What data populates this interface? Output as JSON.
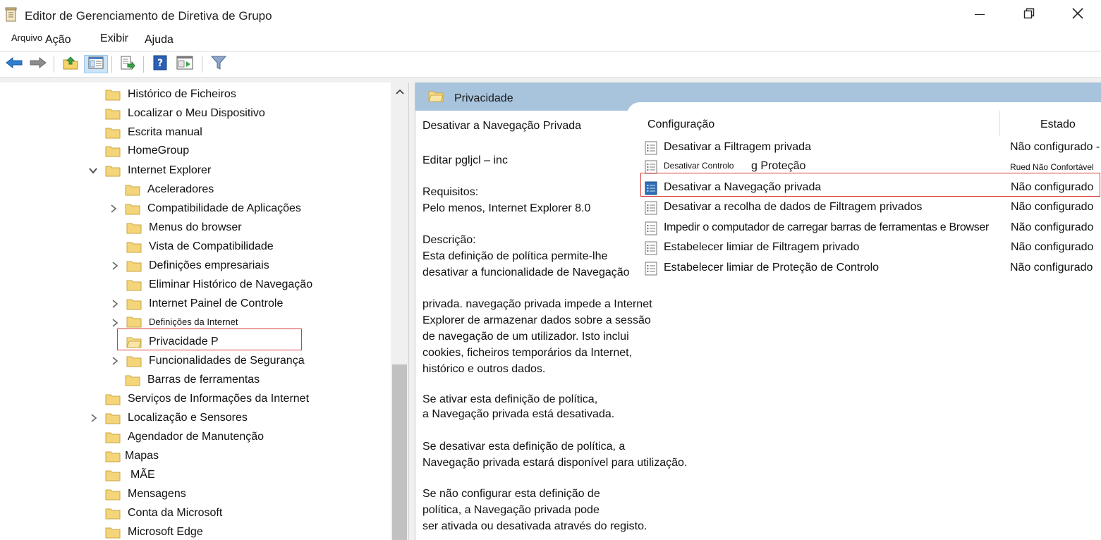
{
  "window": {
    "title": "Editor de Gerenciamento de Diretiva de Grupo",
    "icon": "policy-editor-icon"
  },
  "menu": {
    "file": "Arquivo",
    "action": "Ação",
    "view": "Exibir",
    "help": "Ajuda"
  },
  "toolbar": {
    "icons": [
      "back-arrow-icon",
      "forward-arrow-icon",
      "up-folder-icon",
      "show-hide-tree-icon",
      "export-list-icon",
      "help-icon",
      "properties-icon",
      "filter-icon"
    ]
  },
  "tree": {
    "items": [
      {
        "label": "Histórico de Ficheiros"
      },
      {
        "label": "Localizar o Meu Dispositivo"
      },
      {
        "label": "Escrita manual"
      },
      {
        "label": "HomeGroup"
      },
      {
        "label": "Internet Explorer"
      },
      {
        "label": "Aceleradores"
      },
      {
        "label": "Compatibilidade de Aplicações"
      },
      {
        "label": "Menus do browser"
      },
      {
        "label": "Vista de Compatibilidade"
      },
      {
        "label": "Definições empresariais"
      },
      {
        "label": "Eliminar Histórico de Navegação"
      },
      {
        "label": "Internet Painel de Controle"
      },
      {
        "label": "Definições da Internet"
      },
      {
        "label": "Privacidade P"
      },
      {
        "label": "Funcionalidades de Segurança"
      },
      {
        "label": "Barras de ferramentas"
      },
      {
        "label": "Serviços de Informações da Internet"
      },
      {
        "label": "Localização e Sensores"
      },
      {
        "label": "Agendador de Manutenção"
      },
      {
        "label": "Mapas"
      },
      {
        "label": "MÃE"
      },
      {
        "label": "Mensagens"
      },
      {
        "label": "Conta da Microsoft"
      },
      {
        "label": "Microsoft Edge"
      }
    ]
  },
  "details": {
    "header_title": "Privacidade",
    "description_lines": [
      "Desativar a Navegação Privada",
      "Editar pgljcl – inc",
      "Requisitos:",
      "Pelo menos, Internet Explorer 8.0",
      "Descrição:",
      "Esta definição de política permite-lhe",
      "desativar a funcionalidade de Navegação",
      "privada. navegação privada impede a Internet",
      "Explorer de armazenar dados sobre a sessão",
      "de navegação de um utilizador. Isto inclui",
      "cookies, ficheiros temporários da Internet,",
      "histórico e outros dados.",
      "Se ativar esta definição de política,",
      "a Navegação privada está desativada.",
      "Se desativar esta definição de política, a",
      "Navegação privada estará disponível para utilização.",
      "Se não configurar esta definição de",
      "política, a Navegação privada pode",
      "ser ativada ou desativada através do registo."
    ],
    "columns": {
      "setting": "Configuração",
      "state": "Estado"
    },
    "policies": [
      {
        "name": "Desativar a Filtragem privada",
        "state": "Não  configurado -"
      },
      {
        "name_small": "Desativar Controlo",
        "name_rest": "g Proteção",
        "state": "Rued Não Confortável"
      },
      {
        "name": "Desativar a Navegação privada",
        "state": "Não configurado"
      },
      {
        "name": "Desativar a recolha de dados de Filtragem privados",
        "state": "Não configurado"
      },
      {
        "name": "Impedir o computador de carregar barras de ferramentas e Browser",
        "state": "Não configurado"
      },
      {
        "name": "Estabelecer limiar de Filtragem privado",
        "state": "Não configurado"
      },
      {
        "name": "Estabelecer limiar de Proteção de Controlo",
        "state": "Não configurado"
      }
    ]
  }
}
